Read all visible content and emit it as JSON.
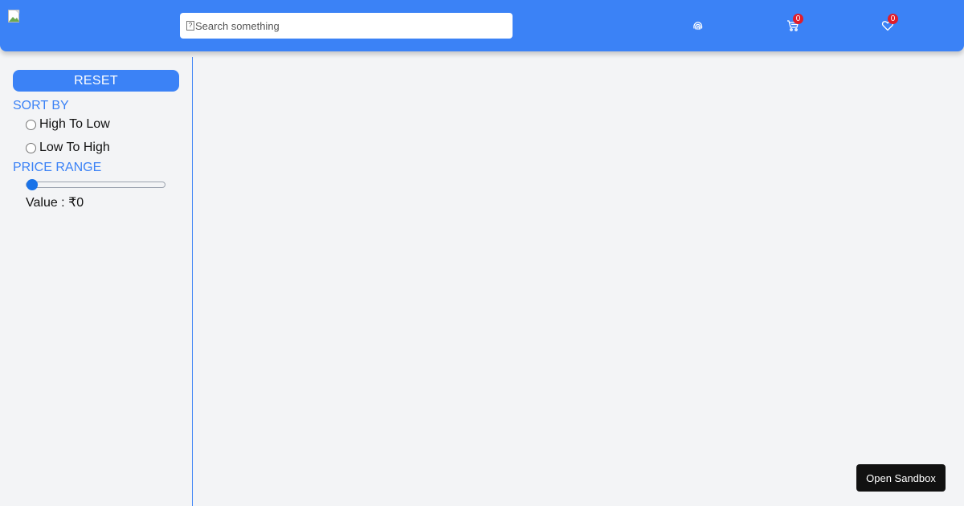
{
  "search": {
    "placeholder": "Search something",
    "icon": "search-icon"
  },
  "nav": {
    "profile_icon": "fingerprint-icon",
    "cart": {
      "icon": "cart-icon",
      "count": "0"
    },
    "wishlist": {
      "icon": "heart-icon",
      "count": "0"
    }
  },
  "colors": {
    "accent": "#3b82f6",
    "badge": "#e11d2a",
    "background": "#f3f4f6"
  },
  "sidebar": {
    "reset_label": "RESET",
    "sort_title": "SORT BY",
    "sort_options": [
      "High To Low",
      "Low To High"
    ],
    "price_title": "PRICE RANGE",
    "price_value_fraction": 0,
    "value_text": "Value : ₹0"
  },
  "sandbox_label": "Open Sandbox"
}
